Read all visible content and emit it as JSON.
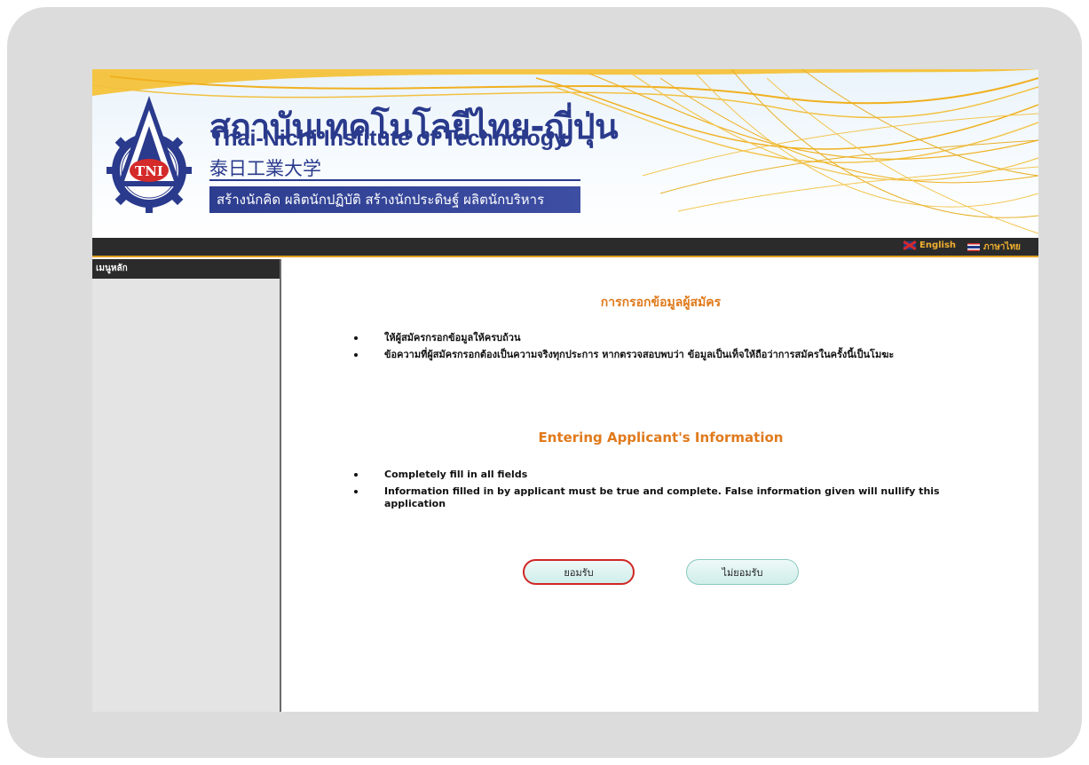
{
  "header": {
    "logo_text": "TNI",
    "title_th": "สถาบันเทคโนโลยีไทย-ญี่ปุ่น",
    "title_en": "Thai-Nichi Institute of Technology",
    "title_jp": "泰日工業大学",
    "slogan": "สร้างนักคิด ผลิตนักปฏิบัติ สร้างนักประดิษฐ์ ผลิตนักบริหาร",
    "colors": {
      "navy": "#2a3a8c",
      "gold": "#f0b020"
    }
  },
  "langbar": {
    "english_label": "English",
    "thai_label": "ภาษาไทย",
    "english_flag_icon": "uk-flag-icon",
    "thai_flag_icon": "thai-flag-icon"
  },
  "sidebar": {
    "title": "เมนูหลัก"
  },
  "main": {
    "heading_th": "การกรอกข้อมูลผู้สมัคร",
    "rules_th": [
      "ให้ผู้สมัครกรอกข้อมูลให้ครบถ้วน",
      "ข้อความที่ผู้สมัครกรอกต้องเป็นความจริงทุกประการ หากตรวจสอบพบว่า ข้อมูลเป็นเท็จให้ถือว่าการสมัครในครั้งนี้เป็นโมฆะ"
    ],
    "heading_en": "Entering Applicant's Information",
    "rules_en": [
      "Completely fill in all fields",
      "Information filled in by applicant must be true and complete. False information given will nullify this application"
    ],
    "accept_label": "ยอมรับ",
    "decline_label": "ไม่ยอมรับ",
    "heading_color": "#e07a1c",
    "highlight_color": "#d22626"
  }
}
